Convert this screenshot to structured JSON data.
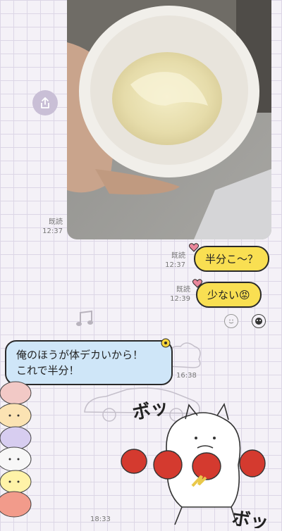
{
  "messages": [
    {
      "id": "photo",
      "direction": "outgoing",
      "type": "image",
      "status": "既読",
      "time": "12:37"
    },
    {
      "id": "m1",
      "direction": "outgoing",
      "type": "text",
      "text": "半分こ〜？",
      "status": "既読",
      "time": "12:37"
    },
    {
      "id": "m2",
      "direction": "outgoing",
      "type": "text",
      "text": "少ない",
      "emoji": "😡",
      "status": "既読",
      "time": "12:39"
    },
    {
      "id": "m3",
      "direction": "incoming",
      "type": "text",
      "lines": [
        "俺のほうが体デカいから！",
        "これで半分！"
      ],
      "time": "16:38"
    },
    {
      "id": "sticker",
      "direction": "incoming",
      "type": "sticker",
      "sfx": [
        "ボッ",
        "ボッ"
      ],
      "time": "18:33"
    }
  ],
  "icons": {
    "share": "share-icon",
    "smile": "smile-reaction-icon",
    "reaction": "reaction-icon"
  },
  "colors": {
    "outgoing_bubble": "#f9df52",
    "incoming_bubble": "#cfe6f8",
    "share_button": "#c9bfd6"
  }
}
